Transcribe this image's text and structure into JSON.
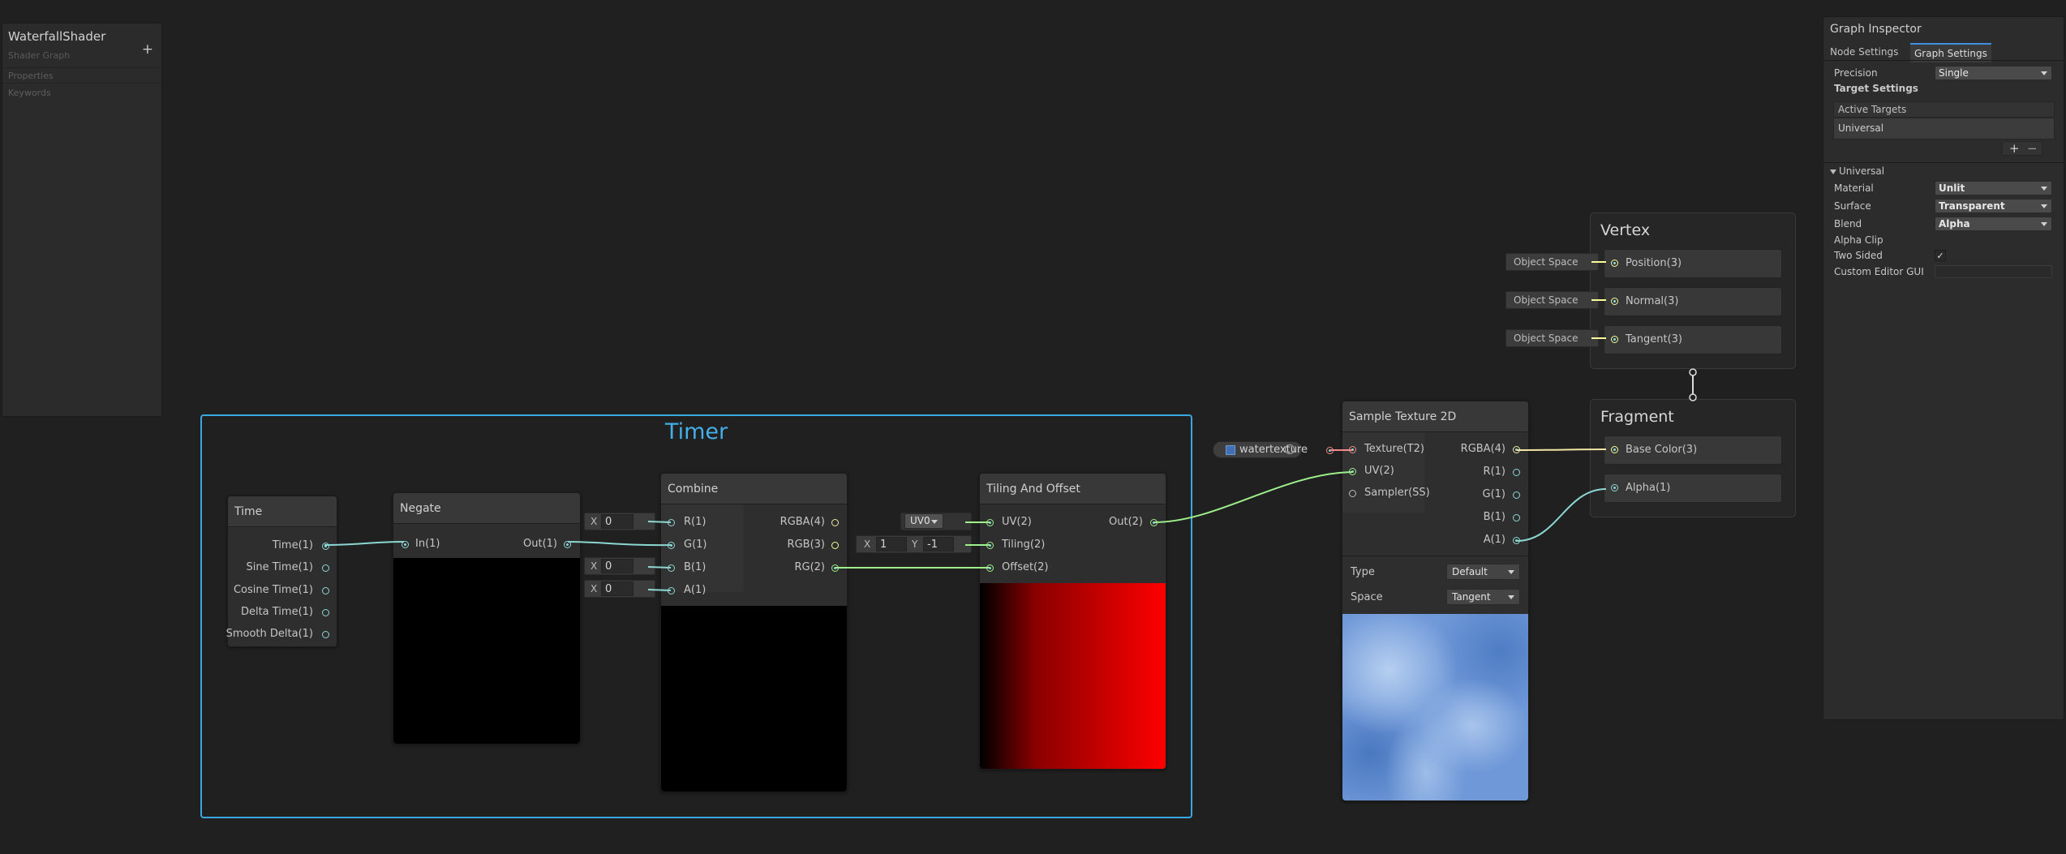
{
  "blackboard": {
    "title": "WaterfallShader",
    "subtitle": "Shader Graph",
    "add_label": "+",
    "sections": [
      "Properties",
      "Keywords"
    ]
  },
  "group": {
    "title": "Timer"
  },
  "nodes": {
    "time": {
      "title": "Time",
      "outputs": [
        "Time(1)",
        "Sine Time(1)",
        "Cosine Time(1)",
        "Delta Time(1)",
        "Smooth Delta(1)"
      ]
    },
    "negate": {
      "title": "Negate",
      "input": "In(1)",
      "output": "Out(1)"
    },
    "combine": {
      "title": "Combine",
      "inputs": [
        "R(1)",
        "G(1)",
        "B(1)",
        "A(1)"
      ],
      "outputs": [
        "RGBA(4)",
        "RGB(3)",
        "RG(2)"
      ],
      "fields": [
        {
          "label": "X",
          "value": "0"
        },
        {
          "label": "X",
          "value": "0"
        },
        {
          "label": "X",
          "value": "0"
        }
      ]
    },
    "tiling": {
      "title": "Tiling And Offset",
      "inputs": [
        "UV(2)",
        "Tiling(2)",
        "Offset(2)"
      ],
      "output": "Out(2)",
      "uv_channel": "UV0",
      "tiling_x_label": "X",
      "tiling_x": "1",
      "tiling_y_label": "Y",
      "tiling_y": "-1"
    },
    "texture_property": {
      "label": "watertexture"
    },
    "sample": {
      "title": "Sample Texture 2D",
      "inputs": [
        "Texture(T2)",
        "UV(2)",
        "Sampler(SS)"
      ],
      "outputs": [
        "RGBA(4)",
        "R(1)",
        "G(1)",
        "B(1)",
        "A(1)"
      ],
      "type_label": "Type",
      "type_value": "Default",
      "space_label": "Space",
      "space_value": "Tangent"
    }
  },
  "vertex": {
    "title": "Vertex",
    "blocks": [
      "Position(3)",
      "Normal(3)",
      "Tangent(3)"
    ],
    "space_fields": [
      "Object Space",
      "Object Space",
      "Object Space"
    ]
  },
  "fragment": {
    "title": "Fragment",
    "blocks": [
      "Base Color(3)",
      "Alpha(1)"
    ]
  },
  "inspector": {
    "title": "Graph Inspector",
    "tabs": [
      "Node Settings",
      "Graph Settings"
    ],
    "active_tab": "Graph Settings",
    "precision_label": "Precision",
    "precision_value": "Single",
    "target_settings_label": "Target Settings",
    "active_targets_label": "Active Targets",
    "targets": [
      "Universal"
    ],
    "add_label": "+",
    "remove_label": "−",
    "universal_section": "Universal",
    "material_label": "Material",
    "material_value": "Unlit",
    "surface_label": "Surface",
    "surface_value": "Transparent",
    "blend_label": "Blend",
    "blend_value": "Alpha",
    "alpha_clip_label": "Alpha Clip",
    "two_sided_label": "Two Sided",
    "two_sided_check": "✓",
    "custom_editor_label": "Custom Editor GUI"
  },
  "colors": {
    "background": "#202020",
    "group_border": "#3aa8e0",
    "float_wire": "#8cd7d3",
    "vector2_wire": "#9ef08a",
    "vector4_wire": "#f3e6a4",
    "texture_wire": "#f28a8a",
    "vector3_wire": "#f6ff9a"
  }
}
